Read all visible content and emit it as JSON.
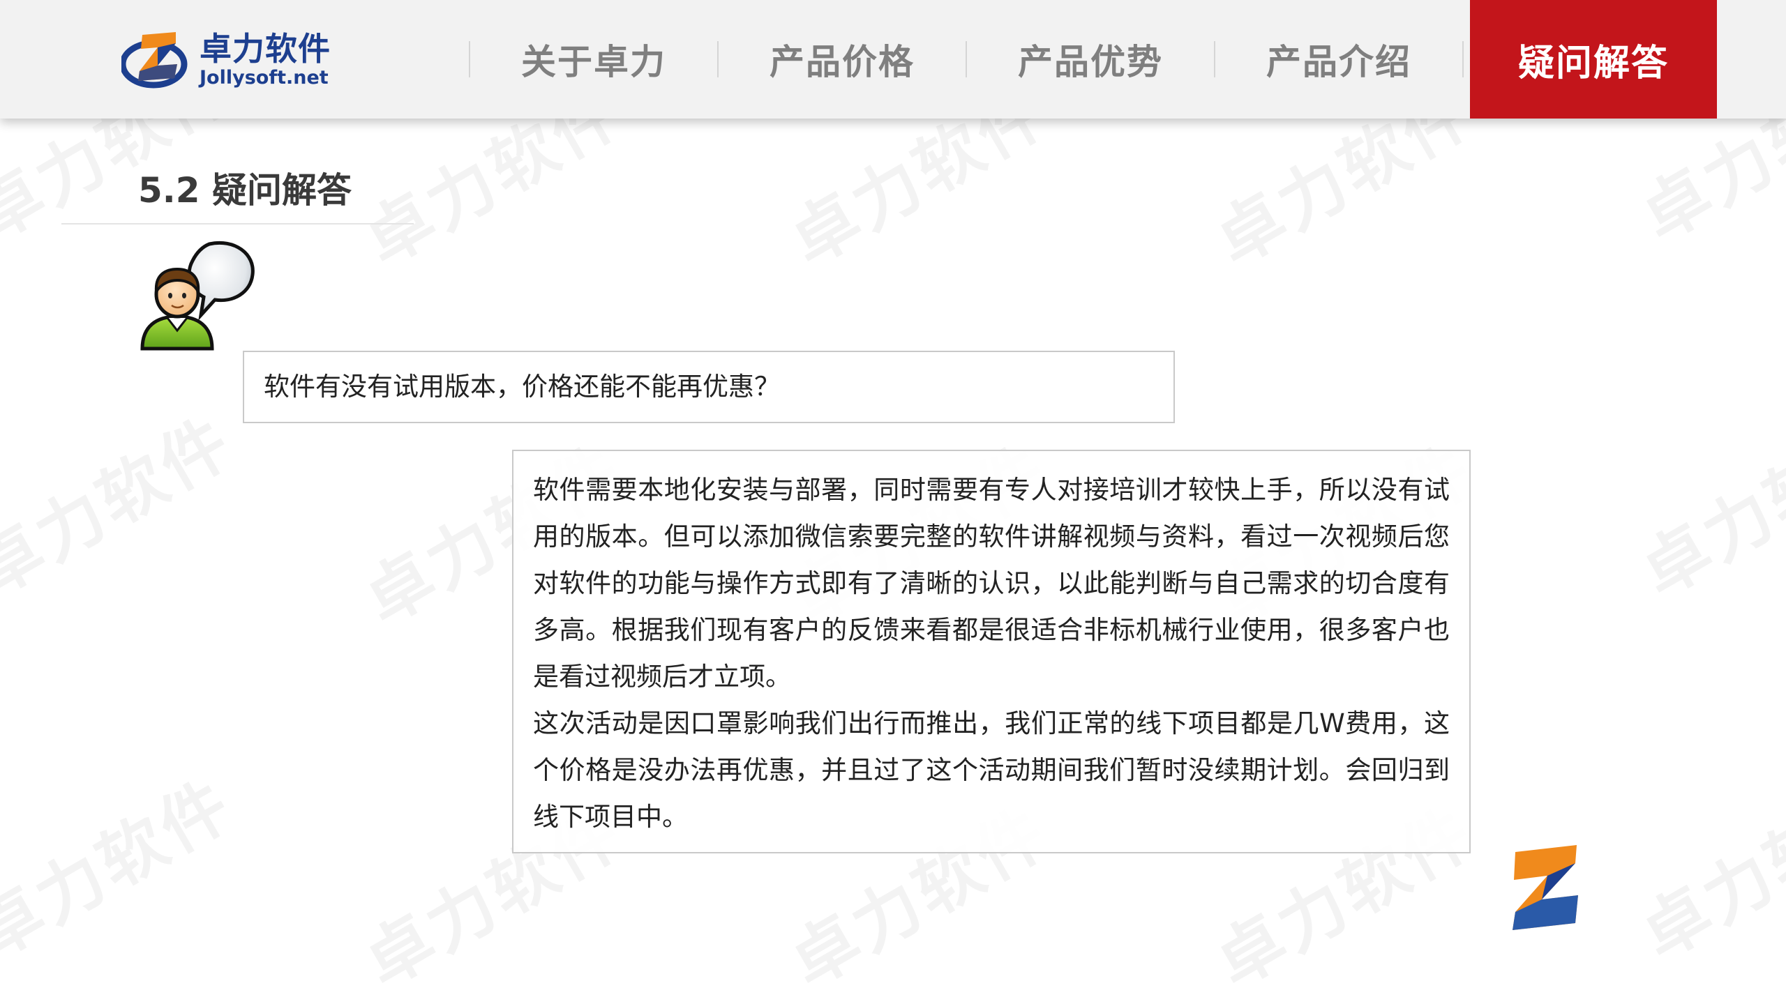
{
  "brand": {
    "name_cn": "卓力软件",
    "domain": "Jollysoft.net",
    "colors": {
      "navy": "#1d3f8f",
      "orange": "#f08a1c",
      "red": "#c3151b"
    }
  },
  "nav": {
    "items": [
      {
        "label": "关于卓力"
      },
      {
        "label": "产品价格"
      },
      {
        "label": "产品优势"
      },
      {
        "label": "产品介绍"
      }
    ],
    "active": {
      "label": "疑问解答"
    }
  },
  "section": {
    "title": "5.2 疑问解答"
  },
  "question": {
    "text": "软件有没有试用版本，价格还能不能再优惠？"
  },
  "answer": {
    "paragraphs": [
      "软件需要本地化安装与部署，同时需要有专人对接培训才较快上手，所以没有试用的版本。但可以添加微信索要完整的软件讲解视频与资料，看过一次视频后您对软件的功能与操作方式即有了清晰的认识，以此能判断与自己需求的切合度有多高。根据我们现有客户的反馈来看都是很适合非标机械行业使用，很多客户也是看过视频后才立项。",
      "这次活动是因口罩影响我们出行而推出，我们正常的线下项目都是几W费用，这个价格是没办法再优惠，并且过了这个活动期间我们暂时没续期计划。会回归到线下项目中。"
    ]
  },
  "watermark": {
    "text": "卓力软件"
  },
  "icons": {
    "logo": "jollysoft-z-logo-icon",
    "avatar": "user-speech-bubble-icon",
    "corner": "jollysoft-z-corner-icon"
  }
}
